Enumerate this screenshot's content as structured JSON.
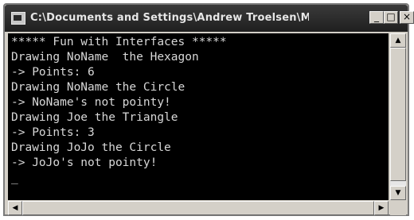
{
  "window": {
    "title": "C:\\Documents and Settings\\Andrew Troelsen\\My ...",
    "minimize_label": "_",
    "maximize_label": "□",
    "close_label": "×"
  },
  "console": {
    "lines": [
      "***** Fun with Interfaces *****",
      "Drawing NoName  the Hexagon",
      "-> Points: 6",
      "Drawing NoName the Circle",
      "-> NoName's not pointy!",
      "Drawing Joe the Triangle",
      "-> Points: 3",
      "Drawing JoJo the Circle",
      "-> JoJo's not pointy!",
      "_"
    ]
  },
  "scrollbars": {
    "up_arrow": "▲",
    "down_arrow": "▼",
    "left_arrow": "◀",
    "right_arrow": "▶"
  }
}
